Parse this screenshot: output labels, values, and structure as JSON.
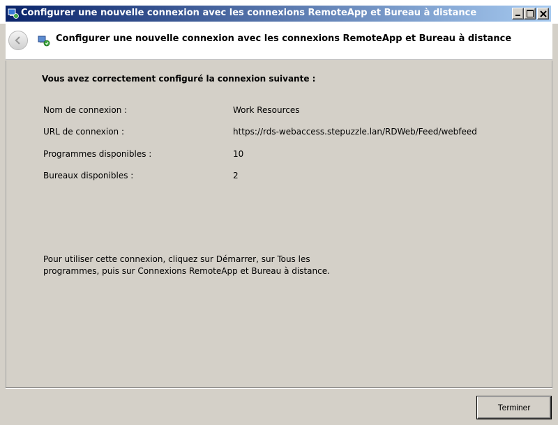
{
  "window": {
    "title": "Configurer une nouvelle connexion avec les connexions RemoteApp et Bureau à distance"
  },
  "header": {
    "title": "Configurer une nouvelle connexion avec les connexions RemoteApp et Bureau à distance",
    "icon": "remoteapp-connection-icon"
  },
  "content": {
    "heading": "Vous avez correctement configuré la connexion suivante :",
    "rows": [
      {
        "label": "Nom de connexion :",
        "value": "Work Resources"
      },
      {
        "label": "URL de connexion :",
        "value": "https://rds-webaccess.stepuzzle.lan/RDWeb/Feed/webfeed"
      },
      {
        "label": "Programmes disponibles :",
        "value": "10"
      },
      {
        "label": "Bureaux disponibles :",
        "value": "2"
      }
    ],
    "instructions": "Pour utiliser cette connexion, cliquez sur Démarrer, sur Tous les programmes, puis sur Connexions RemoteApp et Bureau à distance."
  },
  "footer": {
    "finish_label": "Terminer"
  },
  "colors": {
    "title_bar_start": "#0a246a",
    "title_bar_end": "#a6caf0",
    "window_face": "#d4d0c8"
  }
}
